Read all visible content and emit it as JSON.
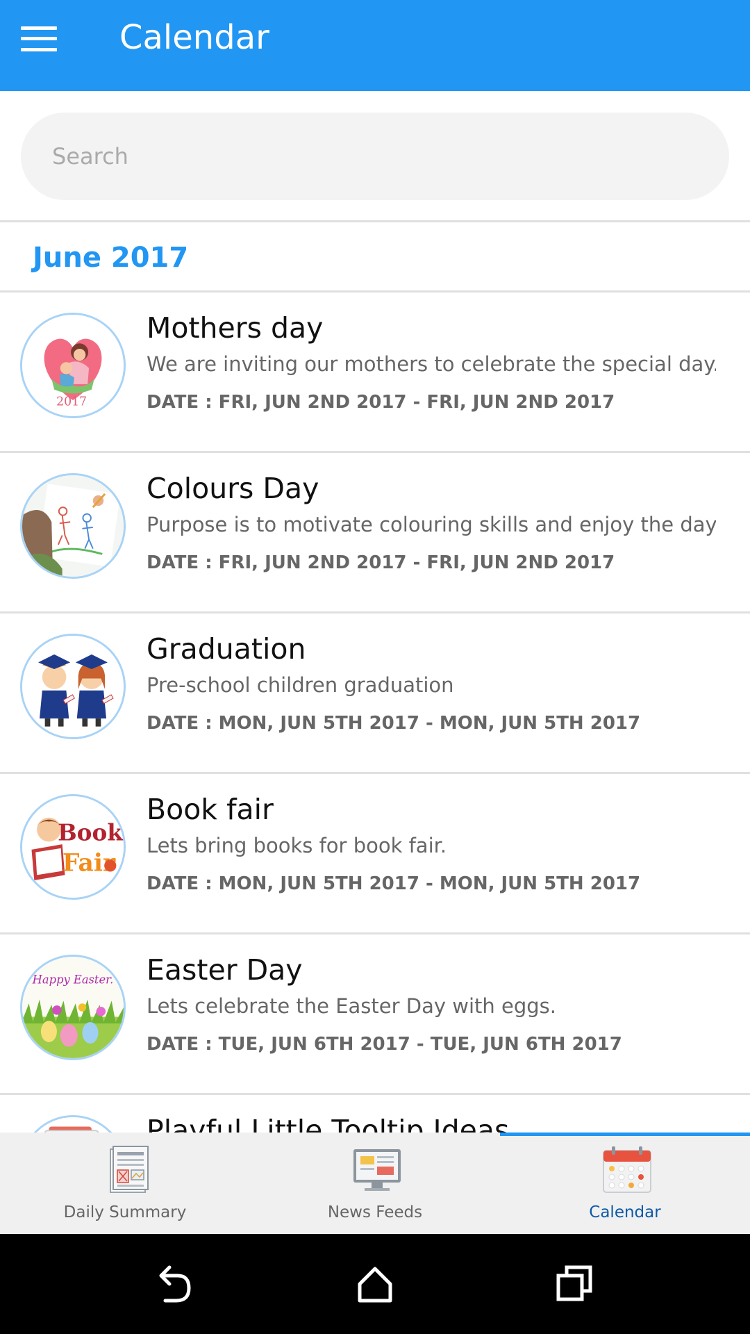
{
  "app": {
    "title": "Calendar",
    "accent_color": "#2196f3"
  },
  "search": {
    "placeholder": "Search",
    "value": ""
  },
  "section": {
    "month": "June 2017"
  },
  "events": [
    {
      "title": "Mothers day",
      "description": "We are inviting our mothers to celebrate the special day.",
      "date": "DATE : FRI, JUN 2ND 2017 - FRI, JUN 2ND 2017",
      "icon": "mothers-day-image",
      "image_text": "2017"
    },
    {
      "title": "Colours Day",
      "description": "Purpose is to motivate colouring skills and enjoy the day ...",
      "date": "DATE : FRI, JUN 2ND 2017 - FRI, JUN 2ND 2017",
      "icon": "colouring-child-image"
    },
    {
      "title": "Graduation",
      "description": "Pre-school children graduation",
      "date": "DATE : MON, JUN 5TH 2017 - MON, JUN 5TH 2017",
      "icon": "graduates-image"
    },
    {
      "title": "Book fair",
      "description": "Lets bring books for book fair.",
      "date": "DATE : MON, JUN 5TH 2017 - MON, JUN 5TH 2017",
      "icon": "book-fair-image",
      "image_text_1": "Book",
      "image_text_2": "Fair"
    },
    {
      "title": "Easter Day",
      "description": "Lets celebrate the Easter Day with eggs.",
      "date": "DATE : TUE, JUN 6TH 2017 - TUE, JUN 6TH 2017",
      "icon": "easter-image",
      "image_text": "Happy Easter."
    },
    {
      "title": "Playful Little Tooltip Ideas",
      "description": "",
      "date": "",
      "icon": "tooltip-image"
    }
  ],
  "bottom_nav": {
    "items": [
      {
        "label": "Daily Summary",
        "icon": "daily-summary-icon",
        "active": false
      },
      {
        "label": "News Feeds",
        "icon": "news-feeds-icon",
        "active": false
      },
      {
        "label": "Calendar",
        "icon": "calendar-icon",
        "active": true
      }
    ],
    "active_label_color": "#0d5aa7"
  },
  "system_nav": {
    "buttons": [
      "back-icon",
      "home-icon",
      "recents-icon"
    ]
  }
}
